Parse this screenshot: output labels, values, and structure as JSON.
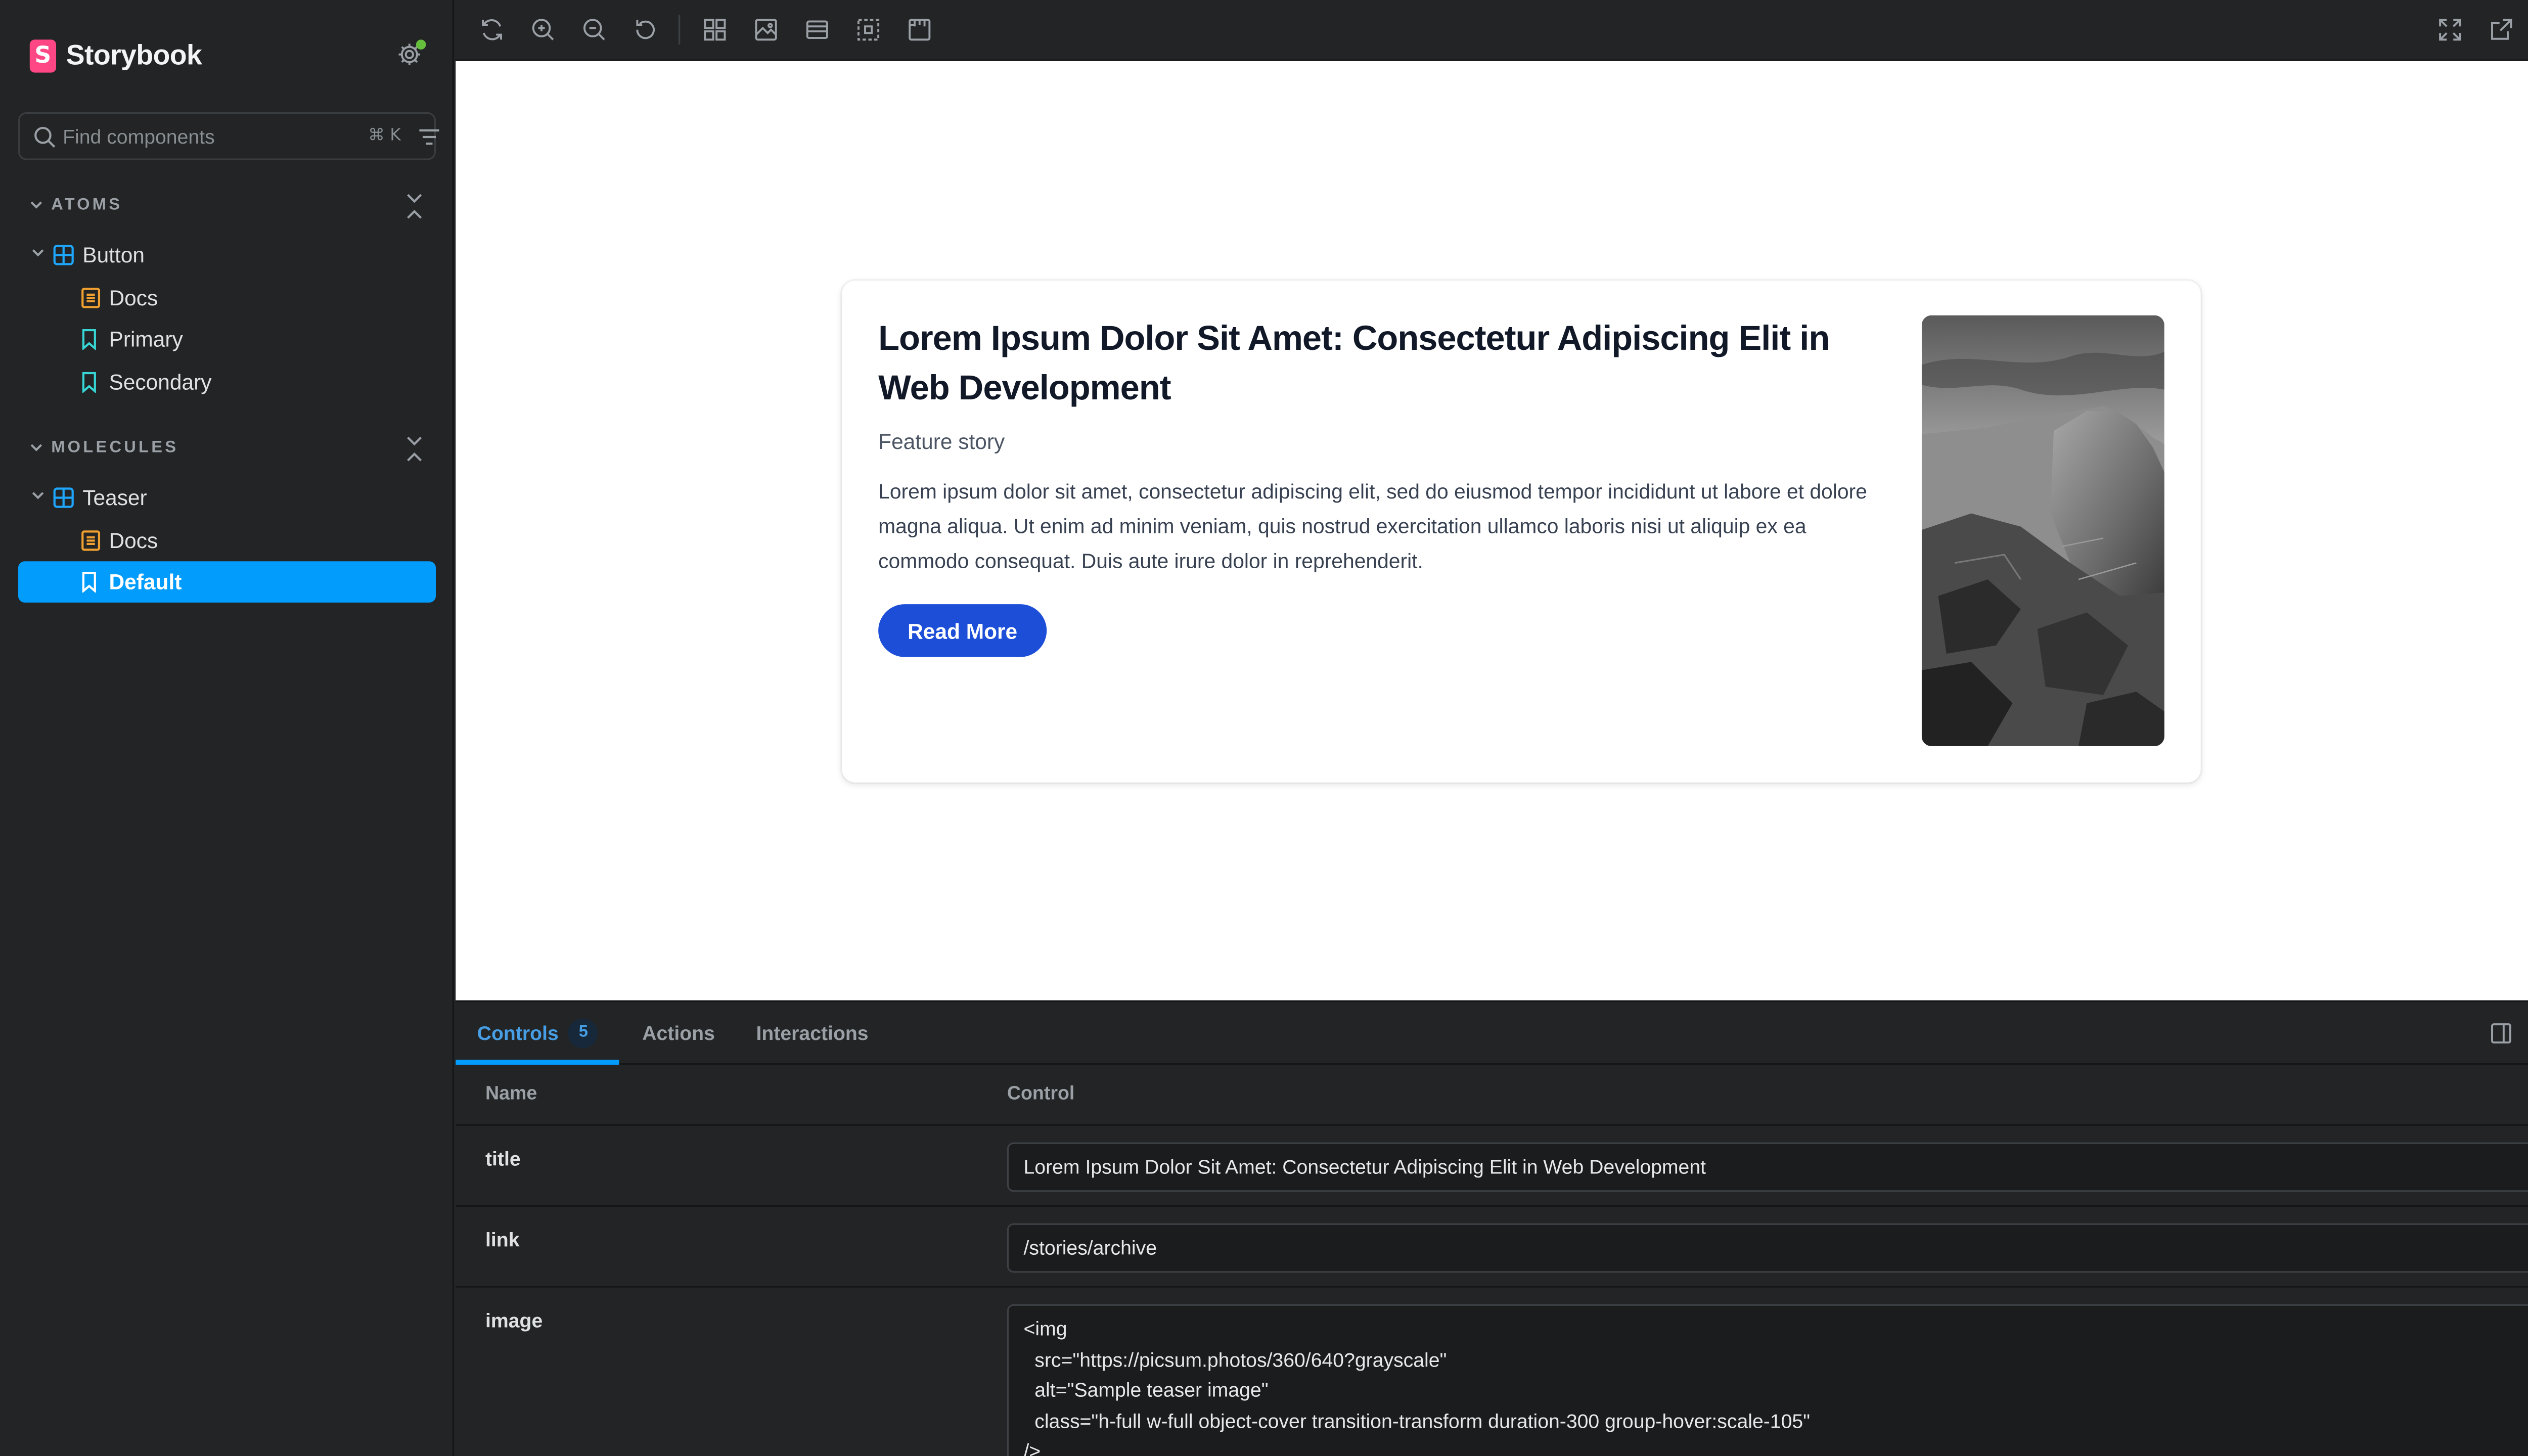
{
  "sidebar": {
    "brand": "Storybook",
    "logo_letter": "S",
    "search_placeholder": "Find components",
    "shortcut": "⌘ K",
    "groups": [
      {
        "label": "ATOMS",
        "component": "Button",
        "items": [
          "Docs",
          "Primary",
          "Secondary"
        ]
      },
      {
        "label": "MOLECULES",
        "component": "Teaser",
        "items": [
          "Docs",
          "Default"
        ]
      }
    ],
    "selected": "Default"
  },
  "preview": {
    "title": "Lorem Ipsum Dolor Sit Amet: Consectetur Adipiscing Elit in Web Development",
    "subtitle": "Feature story",
    "body": "Lorem ipsum dolor sit amet, consectetur adipiscing elit, sed do eiusmod tempor incididunt ut labore et dolore magna aliqua. Ut enim ad minim veniam, quis nostrud exercitation ullamco laboris nisi ut aliquip ex ea commodo consequat. Duis aute irure dolor in reprehenderit.",
    "button": "Read More"
  },
  "addons": {
    "tabs": [
      {
        "label": "Controls",
        "badge": "5"
      },
      {
        "label": "Actions"
      },
      {
        "label": "Interactions"
      }
    ],
    "columns": {
      "name": "Name",
      "control": "Control"
    },
    "rows": [
      {
        "name": "title",
        "value": "Lorem Ipsum Dolor Sit Amet: Consectetur Adipiscing Elit in Web Development"
      },
      {
        "name": "link",
        "value": "/stories/archive"
      },
      {
        "name": "image",
        "value": "<img\n  src=\"https://picsum.photos/360/640?grayscale\"\n  alt=\"Sample teaser image\"\n  class=\"h-full w-full object-cover transition-transform duration-300 group-hover:scale-105\"\n/>"
      }
    ]
  },
  "colors": {
    "accent": "#029cfd",
    "brand": "#ff4785",
    "button": "#1d4ed8",
    "sidebar_bg": "#222425",
    "docs_icon": "#f0a030",
    "story_icon": "#37d5d3",
    "component_icon": "#1ea7fd"
  }
}
